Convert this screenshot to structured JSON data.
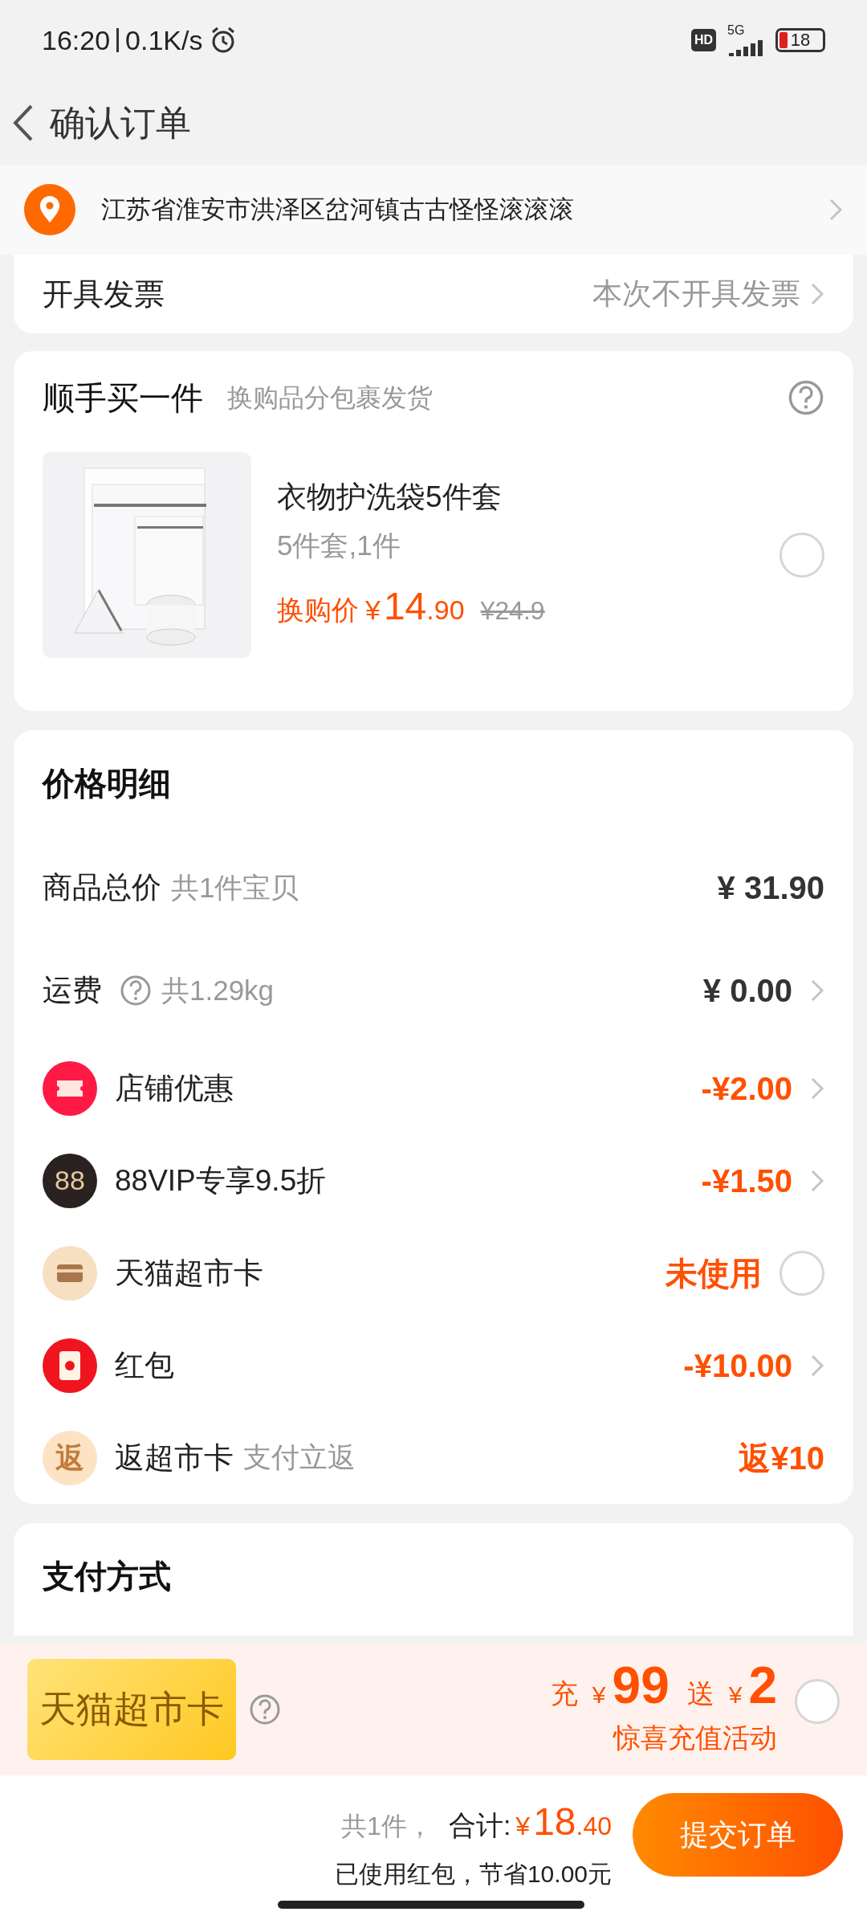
{
  "status_bar": {
    "time": "16:20",
    "speed": "0.1K/s",
    "hd": "HD",
    "network": "5G",
    "battery": "18"
  },
  "header": {
    "title": "确认订单"
  },
  "address": {
    "text": "江苏省淮安市洪泽区岔河镇古古怪怪滚滚滚"
  },
  "invoice": {
    "label": "开具发票",
    "value": "本次不开具发票"
  },
  "addon": {
    "title": "顺手买一件",
    "subtitle": "换购品分包裹发货",
    "product": {
      "name": "衣物护洗袋5件套",
      "spec": "5件套,1件",
      "price_label": "换购价",
      "currency": "¥",
      "price_int": "14",
      "price_dec": ".90",
      "original": "¥24.9",
      "selected": false
    }
  },
  "price_detail": {
    "title": "价格明细",
    "rows": [
      {
        "kind": "total",
        "label": "商品总价",
        "note": "共1件宝贝",
        "value": "¥ 31.90"
      },
      {
        "kind": "shipping",
        "label": "运费",
        "note": "共1.29kg",
        "value": "¥ 0.00"
      },
      {
        "kind": "coupon",
        "label": "店铺优惠",
        "value": "-¥2.00"
      },
      {
        "kind": "member",
        "icon_text": "88",
        "label": "88VIP专享9.5折",
        "value": "-¥1.50"
      },
      {
        "kind": "card",
        "label": "天猫超市卡",
        "value": "未使用",
        "selected": false
      },
      {
        "kind": "envelope",
        "label": "红包",
        "value": "-¥10.00"
      },
      {
        "kind": "cashback",
        "icon_text": "返",
        "label": "返超市卡",
        "note": "支付立返",
        "value": "返¥10"
      }
    ]
  },
  "payment": {
    "title": "支付方式"
  },
  "promo": {
    "card_label": "天猫超市卡",
    "recharge_word": "充",
    "recharge_currency": "¥",
    "recharge_amount": "99",
    "bonus_word": "送",
    "bonus_currency": "¥",
    "bonus_amount": "2",
    "subtitle": "惊喜充值活动",
    "selected": false
  },
  "footer": {
    "count": "共1件，",
    "total_label": "合计:",
    "currency": "¥",
    "total_int": "18",
    "total_dec": ".40",
    "savings": "已使用红包，节省10.00元",
    "submit": "提交订单"
  }
}
